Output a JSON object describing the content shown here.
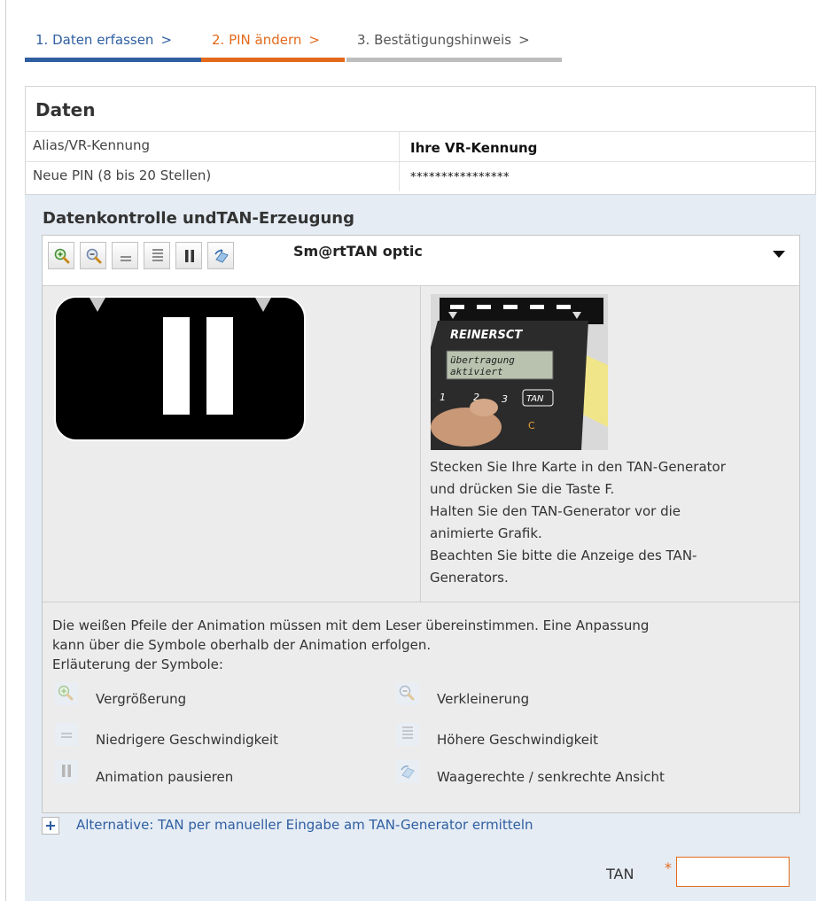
{
  "steps": [
    {
      "label": "1. Daten erfassen",
      "sep": ">",
      "color": "#2f5ea1"
    },
    {
      "label": "2. PIN ändern",
      "sep": ">",
      "color": "#e36a1c"
    },
    {
      "label": "3. Bestätigungshinweis",
      "sep": ">",
      "color": "#bdbdbd"
    }
  ],
  "daten": {
    "title": "Daten",
    "rows": [
      {
        "label": "Alias/VR-Kennung",
        "value": "Ihre VR-Kennung"
      },
      {
        "label": "Neue PIN (8 bis 20 Stellen)",
        "value": "****************"
      }
    ]
  },
  "tan_section": {
    "title": "Datenkontrolle undTAN-Erzeugung",
    "method": "Sm@rtTAN optic",
    "toolbar_icons": [
      "zoom-in-icon",
      "zoom-out-icon",
      "slower-icon",
      "faster-icon",
      "pause-icon",
      "rotate-view-icon"
    ],
    "device": {
      "brand": "REINERSCT",
      "display_line1": "übertragung",
      "display_line2": "aktiviert",
      "keys": [
        "1",
        "2",
        "3",
        "TAN",
        "C"
      ]
    },
    "instructions": [
      "Stecken Sie Ihre Karte in den TAN-Generator",
      "und drücken Sie die Taste F.",
      "Halten Sie den TAN-Generator vor die",
      "animierte Grafik.",
      "Beachten Sie bitte die Anzeige des TAN-",
      "Generators."
    ],
    "note_lines": [
      "Die weißen Pfeile der Animation müssen mit dem Leser übereinstimmen. Eine Anpassung",
      "kann über die Symbole oberhalb der Animation erfolgen."
    ],
    "legend_title": "Erläuterung der Symbole:",
    "legend": [
      {
        "icon": "zoom-in-icon",
        "label": "Vergrößerung"
      },
      {
        "icon": "zoom-out-icon",
        "label": "Verkleinerung"
      },
      {
        "icon": "slower-icon",
        "label": "Niedrigere Geschwindigkeit"
      },
      {
        "icon": "faster-icon",
        "label": "Höhere Geschwindigkeit"
      },
      {
        "icon": "pause-icon",
        "label": "Animation pausieren"
      },
      {
        "icon": "rotate-view-icon",
        "label": "Waagerechte / senkrechte Ansicht"
      }
    ],
    "alternative_link": "Alternative: TAN per manueller Eingabe am TAN-Generator ermitteln",
    "tan_label": "TAN",
    "tan_required_mark": "*",
    "tan_value": ""
  },
  "colors": {
    "accent_blue": "#2f5ea1",
    "accent_orange": "#e36a1c",
    "panel_bg": "#e5ecf4"
  }
}
